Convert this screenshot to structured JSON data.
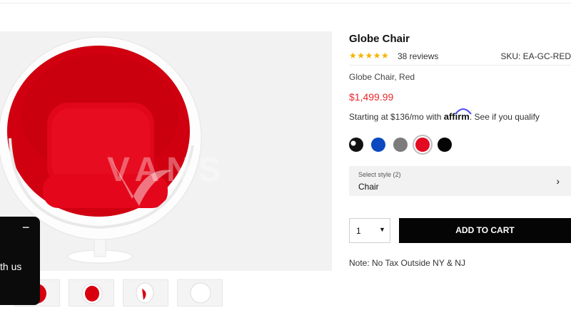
{
  "product": {
    "title": "Globe Chair",
    "stars": "★★★★★",
    "reviews": "38 reviews",
    "sku": "SKU: EA-GC-RED",
    "subtitle": "Globe Chair, Red",
    "price": "$1,499.99",
    "financing_prefix": "Starting at $136/mo with",
    "financing_brand": "affirm",
    "financing_suffix": ". See if you qualify",
    "rating": 5
  },
  "swatches": [
    {
      "name": "black-white",
      "color": "#111111"
    },
    {
      "name": "blue",
      "color": "#0a49c0"
    },
    {
      "name": "grey",
      "color": "#7c7c7c"
    },
    {
      "name": "red",
      "color": "#e30b21",
      "selected": true
    },
    {
      "name": "black",
      "color": "#050505"
    }
  ],
  "style_select": {
    "label": "Select style (2)",
    "value": "Chair",
    "chevron": "›"
  },
  "cart": {
    "quantity": "1",
    "caret": "▼",
    "add_label": "ADD TO CART"
  },
  "note": "Note: No Tax Outside NY & NJ",
  "chat": {
    "minimize": "−",
    "text": "th us"
  },
  "colors": {
    "accent_price": "#e8282f",
    "button_bg": "#050505",
    "star": "#f5b301",
    "chair_red": "#d8000f"
  }
}
